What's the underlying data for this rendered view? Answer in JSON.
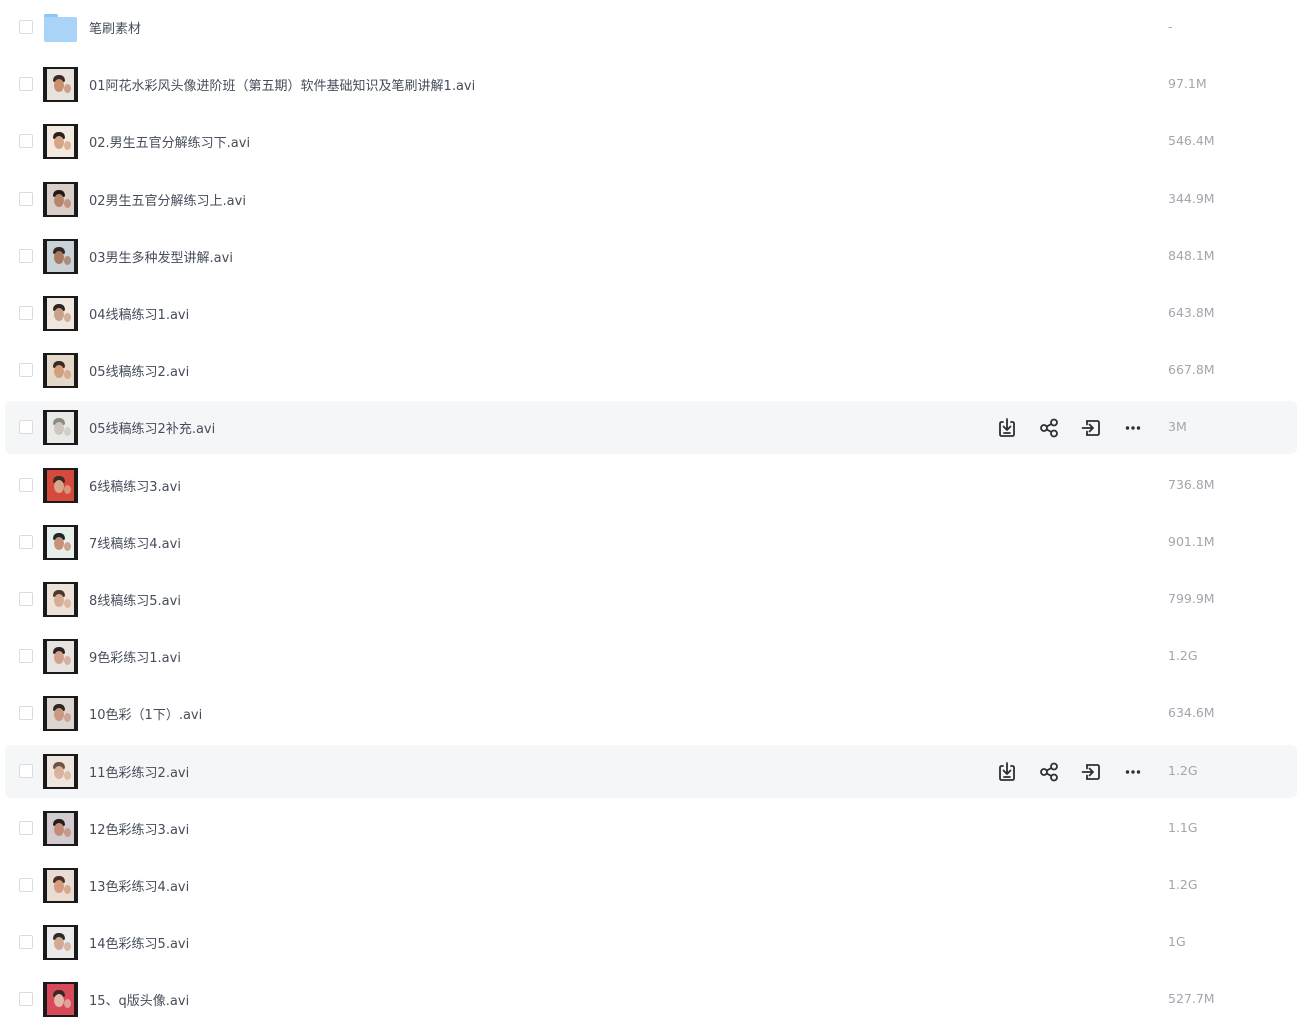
{
  "files": [
    {
      "name": "笔刷素材",
      "size": "-",
      "type": "folder",
      "icon": "folder-icon"
    },
    {
      "name": "01阿花水彩风头像进阶班（第五期）软件基础知识及笔刷讲解1.avi",
      "size": "97.1M",
      "type": "video",
      "icon": "video-thumbnail"
    },
    {
      "name": "02.男生五官分解练习下.avi",
      "size": "546.4M",
      "type": "video",
      "icon": "video-thumbnail"
    },
    {
      "name": "02男生五官分解练习上.avi",
      "size": "344.9M",
      "type": "video",
      "icon": "video-thumbnail"
    },
    {
      "name": "03男生多种发型讲解.avi",
      "size": "848.1M",
      "type": "video",
      "icon": "video-thumbnail"
    },
    {
      "name": "04线稿练习1.avi",
      "size": "643.8M",
      "type": "video",
      "icon": "video-thumbnail"
    },
    {
      "name": "05线稿练习2.avi",
      "size": "667.8M",
      "type": "video",
      "icon": "video-thumbnail"
    },
    {
      "name": "05线稿练习2补充.avi",
      "size": "3M",
      "type": "video",
      "icon": "video-thumbnail",
      "hover": true
    },
    {
      "name": "6线稿练习3.avi",
      "size": "736.8M",
      "type": "video",
      "icon": "video-thumbnail"
    },
    {
      "name": "7线稿练习4.avi",
      "size": "901.1M",
      "type": "video",
      "icon": "video-thumbnail"
    },
    {
      "name": "8线稿练习5.avi",
      "size": "799.9M",
      "type": "video",
      "icon": "video-thumbnail"
    },
    {
      "name": "9色彩练习1.avi",
      "size": "1.2G",
      "type": "video",
      "icon": "video-thumbnail"
    },
    {
      "name": "10色彩（1下）.avi",
      "size": "634.6M",
      "type": "video",
      "icon": "video-thumbnail"
    },
    {
      "name": "11色彩练习2.avi",
      "size": "1.2G",
      "type": "video",
      "icon": "video-thumbnail",
      "hover": true
    },
    {
      "name": "12色彩练习3.avi",
      "size": "1.1G",
      "type": "video",
      "icon": "video-thumbnail"
    },
    {
      "name": "13色彩练习4.avi",
      "size": "1.2G",
      "type": "video",
      "icon": "video-thumbnail"
    },
    {
      "name": "14色彩练习5.avi",
      "size": "1G",
      "type": "video",
      "icon": "video-thumbnail"
    },
    {
      "name": "15、q版头像.avi",
      "size": "527.7M",
      "type": "video",
      "icon": "video-thumbnail"
    }
  ],
  "row_actions": [
    {
      "icon": "download-icon"
    },
    {
      "icon": "share-icon"
    },
    {
      "icon": "move-to-icon"
    },
    {
      "icon": "more-icon"
    }
  ],
  "colors": {
    "text": "#454d5a",
    "size_text": "#a2a6ad",
    "hover_bg": "#f5f6f7",
    "icon": "#2b2f36",
    "folder": "#a9d4f7"
  }
}
